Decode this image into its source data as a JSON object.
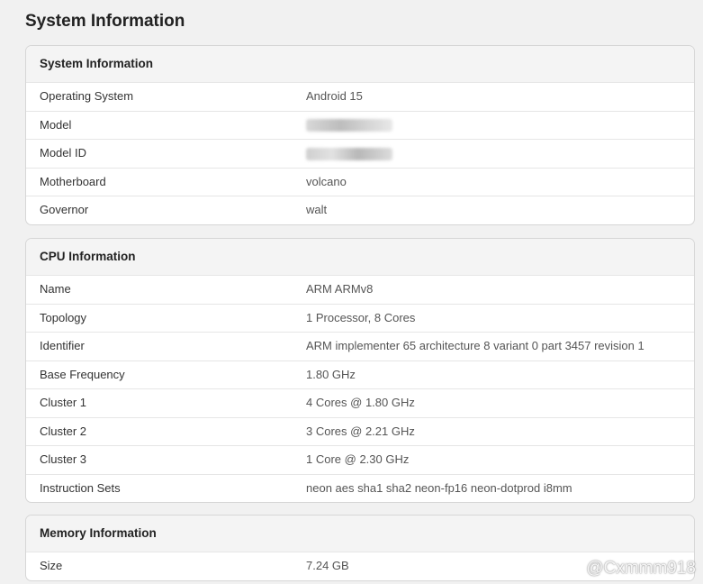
{
  "page": {
    "title": "System Information"
  },
  "system": {
    "header": "System Information",
    "rows": [
      {
        "key": "Operating System",
        "value": "Android 15"
      },
      {
        "key": "Model",
        "value": ""
      },
      {
        "key": "Model ID",
        "value": ""
      },
      {
        "key": "Motherboard",
        "value": "volcano"
      },
      {
        "key": "Governor",
        "value": "walt"
      }
    ]
  },
  "cpu": {
    "header": "CPU Information",
    "rows": [
      {
        "key": "Name",
        "value": "ARM ARMv8"
      },
      {
        "key": "Topology",
        "value": "1 Processor, 8 Cores"
      },
      {
        "key": "Identifier",
        "value": "ARM implementer 65 architecture 8 variant 0 part 3457 revision 1"
      },
      {
        "key": "Base Frequency",
        "value": "1.80 GHz"
      },
      {
        "key": "Cluster 1",
        "value": "4 Cores @ 1.80 GHz"
      },
      {
        "key": "Cluster 2",
        "value": "3 Cores @ 2.21 GHz"
      },
      {
        "key": "Cluster 3",
        "value": "1 Core @ 2.30 GHz"
      },
      {
        "key": "Instruction Sets",
        "value": "neon aes sha1 sha2 neon-fp16 neon-dotprod i8mm"
      }
    ]
  },
  "memory": {
    "header": "Memory Information",
    "rows": [
      {
        "key": "Size",
        "value": "7.24 GB"
      }
    ]
  },
  "watermark": {
    "icon": "weibo-icon",
    "text": "@Cxmmm918"
  }
}
